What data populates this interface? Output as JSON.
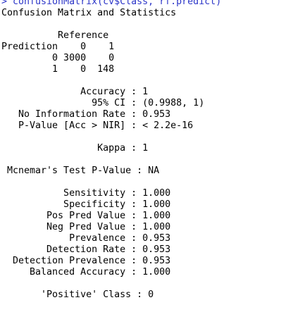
{
  "console": {
    "command_line": "> confusionMatrix(cv$Class, rf.predict)",
    "title": "Confusion Matrix and Statistics",
    "matrix": {
      "header_reference": "          Reference",
      "header_prediction": "Prediction    0    1",
      "row_0": "         0 3000    0",
      "row_1": "         1    0  148"
    },
    "overall": {
      "accuracy": "              Accuracy : 1",
      "ci": "                95% CI : (0.9988, 1)",
      "nir": "   No Information Rate : 0.953",
      "pvalue": "   P-Value [Acc > NIR] : < 2.2e-16"
    },
    "kappa": "                 Kappa : 1",
    "mcnemar": " Mcnemar's Test P-Value : NA",
    "by_class": {
      "sensitivity": "           Sensitivity : 1.000",
      "specificity": "           Specificity : 1.000",
      "pos_pred": "        Pos Pred Value : 1.000",
      "neg_pred": "        Neg Pred Value : 1.000",
      "prevalence": "            Prevalence : 0.953",
      "detection_rate": "        Detection Rate : 0.953",
      "detection_prevalence": "  Detection Prevalence : 0.953",
      "balanced_accuracy": "     Balanced Accuracy : 1.000"
    },
    "positive_class": "       'Positive' Class : 0"
  },
  "colors": {
    "command": "#2b35c8",
    "output": "#000000",
    "background": "#ffffff"
  }
}
